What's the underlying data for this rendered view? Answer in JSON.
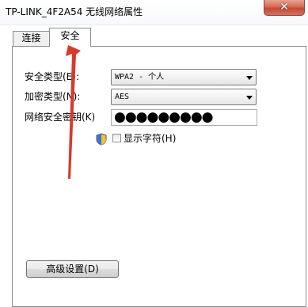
{
  "window": {
    "title": "TP-LINK_4F2A54 无线网络属性",
    "close_label": "✕"
  },
  "tabs": [
    {
      "label": "连接",
      "selected": false
    },
    {
      "label": "安全",
      "selected": true
    }
  ],
  "security": {
    "type_label": "安全类型(E):",
    "type_value": "WPA2 - 个人",
    "encryption_label": "加密类型(N):",
    "encryption_value": "AES",
    "key_label": "网络安全密钥(K)",
    "key_value": "●●●●●●●●●",
    "show_chars_label": "显示字符(H)",
    "show_chars_checked": false
  },
  "advanced_button_label": "高级设置(D)",
  "colors": {
    "annotation_arrow": "#d83a2c",
    "close_button": "#c44a33"
  }
}
